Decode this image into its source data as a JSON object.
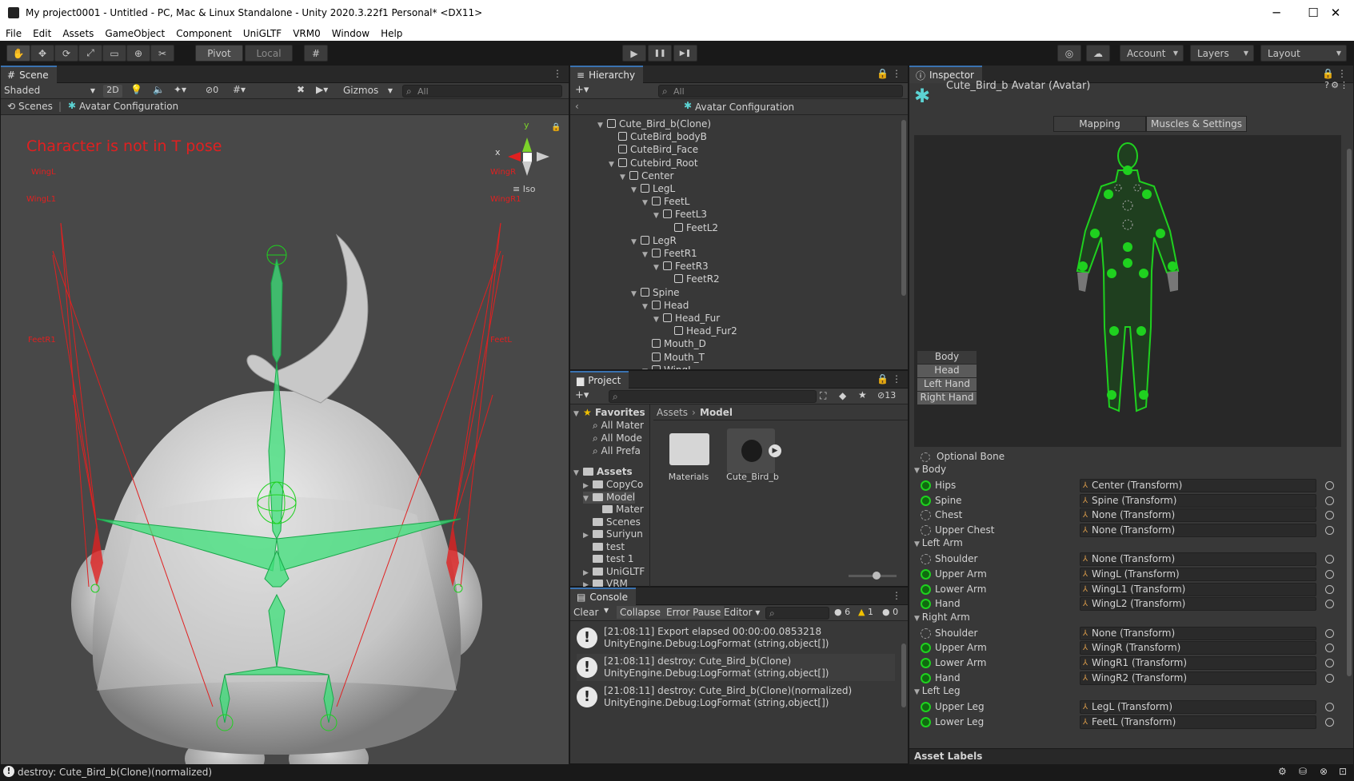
{
  "window": {
    "title": "My project0001 - Untitled - PC, Mac & Linux Standalone - Unity 2020.3.22f1 Personal* <DX11>",
    "minimize": "─",
    "maximize": "☐",
    "close": "✕"
  },
  "menu": [
    "File",
    "Edit",
    "Assets",
    "GameObject",
    "Component",
    "UniGLTF",
    "VRM0",
    "Window",
    "Help"
  ],
  "toolbar": {
    "pivot": "Pivot",
    "local": "Local",
    "account": "Account",
    "layers": "Layers",
    "layout": "Layout",
    "play": "▶",
    "pause": "❚❚",
    "step": "▶❚"
  },
  "scene": {
    "tab": "Scene",
    "shading": "Shaded",
    "mode2d": "2D",
    "hidden_count": "0",
    "gizmos": "Gizmos",
    "search_placeholder": "All",
    "breadcrumb_scenes": "Scenes",
    "breadcrumb_current": "Avatar Configuration",
    "warning": "Character is not in T pose",
    "axis_x": "x",
    "axis_y": "y",
    "iso": "Iso",
    "bone_labels": {
      "wingl": "WingL",
      "wingl1": "WingL1",
      "wingr": "WingR",
      "wingr1": "WingR1",
      "feetr1": "FeetR1",
      "feetl": "FeetL"
    }
  },
  "hierarchy": {
    "tab": "Hierarchy",
    "search_placeholder": "All",
    "header": "Avatar Configuration",
    "items": [
      {
        "label": "Cute_Bird_b(Clone)",
        "depth": 0,
        "expand": true
      },
      {
        "label": "CuteBird_bodyB",
        "depth": 1,
        "expand": false
      },
      {
        "label": "CuteBird_Face",
        "depth": 1,
        "expand": false
      },
      {
        "label": "Cutebird_Root",
        "depth": 1,
        "expand": true
      },
      {
        "label": "Center",
        "depth": 2,
        "expand": true
      },
      {
        "label": "LegL",
        "depth": 3,
        "expand": true
      },
      {
        "label": "FeetL",
        "depth": 4,
        "expand": true
      },
      {
        "label": "FeetL3",
        "depth": 5,
        "expand": true
      },
      {
        "label": "FeetL2",
        "depth": 6,
        "expand": false
      },
      {
        "label": "LegR",
        "depth": 3,
        "expand": true
      },
      {
        "label": "FeetR1",
        "depth": 4,
        "expand": true
      },
      {
        "label": "FeetR3",
        "depth": 5,
        "expand": true
      },
      {
        "label": "FeetR2",
        "depth": 6,
        "expand": false
      },
      {
        "label": "Spine",
        "depth": 3,
        "expand": true
      },
      {
        "label": "Head",
        "depth": 4,
        "expand": true
      },
      {
        "label": "Head_Fur",
        "depth": 5,
        "expand": true
      },
      {
        "label": "Head_Fur2",
        "depth": 6,
        "expand": false
      },
      {
        "label": "Mouth_D",
        "depth": 4,
        "expand": false
      },
      {
        "label": "Mouth_T",
        "depth": 4,
        "expand": false
      },
      {
        "label": "WingL",
        "depth": 4,
        "expand": true
      }
    ]
  },
  "project": {
    "tab": "Project",
    "hidden_count": "13",
    "favorites": "Favorites",
    "fav_items": [
      "All Mater",
      "All Mode",
      "All Prefa"
    ],
    "assets": "Assets",
    "tree": [
      {
        "label": "CopyCo",
        "depth": 1,
        "expand": "▶"
      },
      {
        "label": "Model",
        "depth": 1,
        "expand": "▼"
      },
      {
        "label": "Mater",
        "depth": 2,
        "expand": ""
      },
      {
        "label": "Scenes",
        "depth": 1,
        "expand": ""
      },
      {
        "label": "Suriyun",
        "depth": 1,
        "expand": "▶"
      },
      {
        "label": "test",
        "depth": 1,
        "expand": ""
      },
      {
        "label": "test 1",
        "depth": 1,
        "expand": ""
      },
      {
        "label": "UniGLTF",
        "depth": 1,
        "expand": "▶"
      },
      {
        "label": "VRM",
        "depth": 1,
        "expand": "▶"
      }
    ],
    "path_root": "Assets",
    "path_sep": "›",
    "path_current": "Model",
    "grid_items": [
      "Materials",
      "Cute_Bird_b"
    ]
  },
  "console": {
    "tab": "Console",
    "clear": "Clear",
    "collapse": "Collapse",
    "error_pause": "Error Pause",
    "editor": "Editor",
    "info_count": "6",
    "warn_count": "1",
    "error_count": "0",
    "entries": [
      {
        "line1": "[21:08:11] Export elapsed 00:00:00.0853218",
        "line2": "UnityEngine.Debug:LogFormat (string,object[])"
      },
      {
        "line1": "[21:08:11] destroy: Cute_Bird_b(Clone)",
        "line2": "UnityEngine.Debug:LogFormat (string,object[])"
      },
      {
        "line1": "[21:08:11] destroy: Cute_Bird_b(Clone)(normalized)",
        "line2": "UnityEngine.Debug:LogFormat (string,object[])"
      }
    ]
  },
  "inspector": {
    "tab": "Inspector",
    "title": "Cute_Bird_b Avatar (Avatar)",
    "tab_mapping": "Mapping",
    "tab_muscles": "Muscles & Settings",
    "view_buttons": [
      "Body",
      "Head",
      "Left Hand",
      "Right Hand"
    ],
    "optional_bone": "Optional Bone",
    "groups": [
      {
        "name": "Body",
        "rows": [
          {
            "bone": "Hips",
            "value": "Center (Transform)",
            "set": true
          },
          {
            "bone": "Spine",
            "value": "Spine (Transform)",
            "set": true
          },
          {
            "bone": "Chest",
            "value": "None (Transform)",
            "set": false
          },
          {
            "bone": "Upper Chest",
            "value": "None (Transform)",
            "set": false
          }
        ]
      },
      {
        "name": "Left Arm",
        "rows": [
          {
            "bone": "Shoulder",
            "value": "None (Transform)",
            "set": false
          },
          {
            "bone": "Upper Arm",
            "value": "WingL (Transform)",
            "set": true
          },
          {
            "bone": "Lower Arm",
            "value": "WingL1 (Transform)",
            "set": true
          },
          {
            "bone": "Hand",
            "value": "WingL2 (Transform)",
            "set": true
          }
        ]
      },
      {
        "name": "Right Arm",
        "rows": [
          {
            "bone": "Shoulder",
            "value": "None (Transform)",
            "set": false
          },
          {
            "bone": "Upper Arm",
            "value": "WingR (Transform)",
            "set": true
          },
          {
            "bone": "Lower Arm",
            "value": "WingR1 (Transform)",
            "set": true
          },
          {
            "bone": "Hand",
            "value": "WingR2 (Transform)",
            "set": true
          }
        ]
      },
      {
        "name": "Left Leg",
        "rows": [
          {
            "bone": "Upper Leg",
            "value": "LegL (Transform)",
            "set": true
          },
          {
            "bone": "Lower Leg",
            "value": "FeetL (Transform)",
            "set": true
          }
        ]
      }
    ],
    "asset_labels": "Asset Labels"
  },
  "status": {
    "message": "destroy: Cute_Bird_b(Clone)(normalized)"
  },
  "colors": {
    "accent": "#3a72b0",
    "bone_green": "#1fd11f",
    "warning_red": "#e02020"
  }
}
